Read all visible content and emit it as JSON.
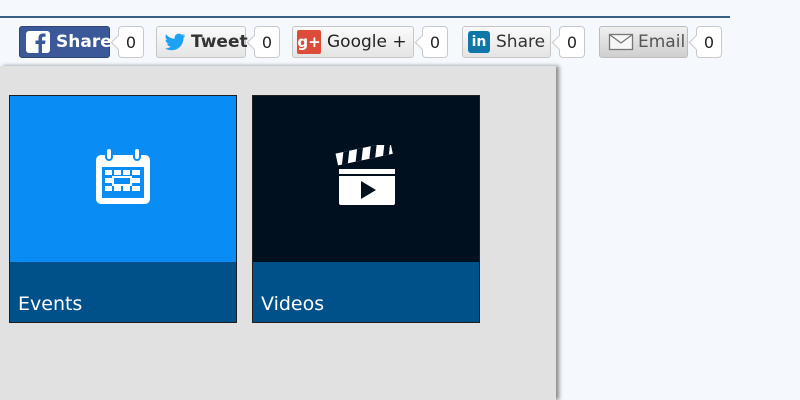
{
  "share_bar": {
    "facebook": {
      "label": "Share",
      "count": "0",
      "icon": "facebook-icon"
    },
    "twitter": {
      "label": "Tweet",
      "count": "0",
      "icon": "twitter-bird-icon"
    },
    "google": {
      "label": "Google +",
      "count": "0",
      "icon": "google-plus-icon",
      "icon_text": "g+"
    },
    "linkedin": {
      "label": "Share",
      "count": "0",
      "icon": "linkedin-icon",
      "icon_text": "in"
    },
    "email": {
      "label": "Email",
      "count": "0",
      "icon": "envelope-icon"
    }
  },
  "tiles": [
    {
      "label": "Events",
      "icon": "calendar-icon",
      "color": "#0a8cf5"
    },
    {
      "label": "Videos",
      "icon": "clapperboard-icon",
      "color": "#00101f"
    }
  ],
  "colors": {
    "facebook_blue": "#3b5998",
    "tile_footer": "#00508a",
    "panel_bg": "#e1e1e1"
  }
}
